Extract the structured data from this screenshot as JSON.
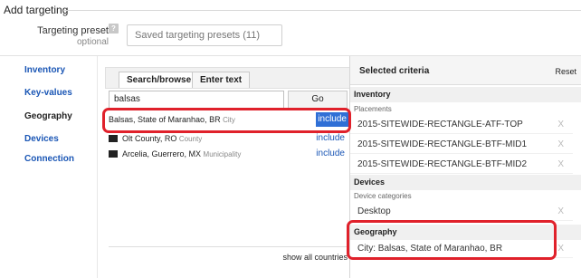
{
  "section": {
    "title": "Add targeting"
  },
  "preset": {
    "label": "Targeting preset",
    "help_glyph": "?",
    "optional": "optional",
    "value": "Saved targeting presets (11)"
  },
  "nav": [
    {
      "label": "Inventory",
      "active": false
    },
    {
      "label": "Key-values",
      "active": false
    },
    {
      "label": "Geography",
      "active": true
    },
    {
      "label": "Devices",
      "active": false
    },
    {
      "label": "Connection",
      "active": false
    }
  ],
  "center": {
    "tabs": [
      {
        "label": "Search/browse",
        "active": true
      },
      {
        "label": "Enter text",
        "active": false
      }
    ],
    "search": {
      "value": "balsas"
    },
    "go_label": "Go",
    "results": [
      {
        "name": "Balsas, State of Maranhao, BR",
        "type": "City",
        "action": "include",
        "folder": false,
        "highlighted": true
      },
      {
        "name": "Olt County, RO",
        "type": "County",
        "action": "include",
        "folder": true,
        "highlighted": false
      },
      {
        "name": "Arcelia, Guerrero, MX",
        "type": "Municipality",
        "action": "include",
        "folder": true,
        "highlighted": false
      }
    ],
    "show_all": "show all countries"
  },
  "criteria": {
    "title": "Selected criteria",
    "reset_label": "Reset",
    "remove_glyph": "X",
    "inventory": {
      "heading": "Inventory",
      "sub": "Placements",
      "items": [
        "2015-SITEWIDE-RECTANGLE-ATF-TOP",
        "2015-SITEWIDE-RECTANGLE-BTF-MID1",
        "2015-SITEWIDE-RECTANGLE-BTF-MID2"
      ]
    },
    "devices": {
      "heading": "Devices",
      "sub": "Device categories",
      "items": [
        "Desktop"
      ]
    },
    "geography": {
      "heading": "Geography",
      "items": [
        "City: Balsas, State of Maranhao, BR"
      ]
    }
  },
  "colors": {
    "link": "#1a56b5",
    "highlight": "#e0212b",
    "include_selected_bg": "#2f6fd6"
  }
}
